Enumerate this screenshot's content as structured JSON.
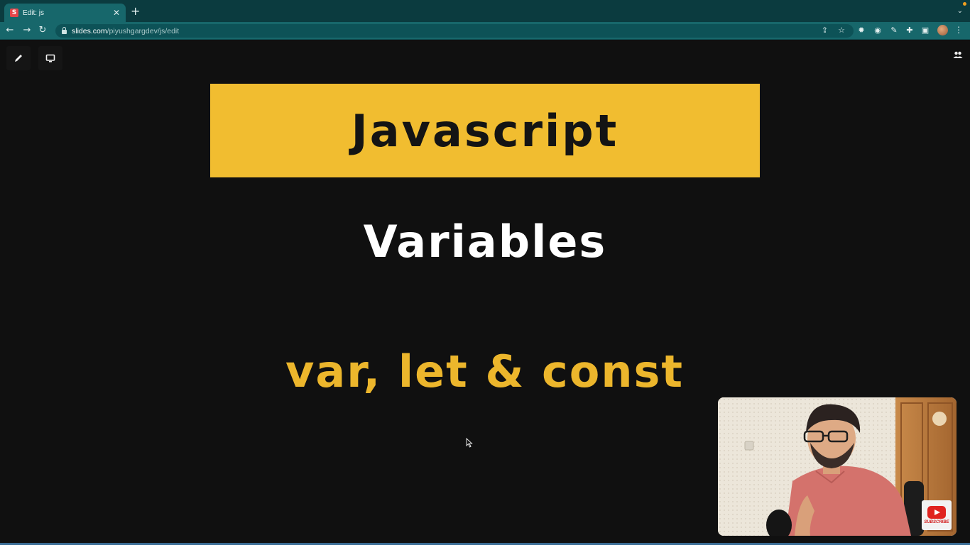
{
  "browser": {
    "tab": {
      "favicon_letter": "S",
      "title": "Edit: js"
    },
    "new_tab_label": "+",
    "address": {
      "host": "slides.com",
      "path": "/piyushgargdev/js/edit"
    },
    "accent_colors": {
      "tabstrip": "#0b3b3f",
      "toolbar": "#17676b"
    }
  },
  "editor": {
    "tools": [
      {
        "name": "pencil-icon"
      },
      {
        "name": "present-icon"
      }
    ],
    "collaborators_icon": "people-icon"
  },
  "slide": {
    "title": "Javascript",
    "subtitle": "Variables",
    "keywords": "var, let & const",
    "colors": {
      "background": "#101010",
      "band": "#f1bd30",
      "keywords": "#ecb62c",
      "subtitle": "#ffffff"
    }
  },
  "webcam": {
    "subscribe_label": "SUBSCRIBE",
    "badge_icon": "youtube-icon"
  }
}
